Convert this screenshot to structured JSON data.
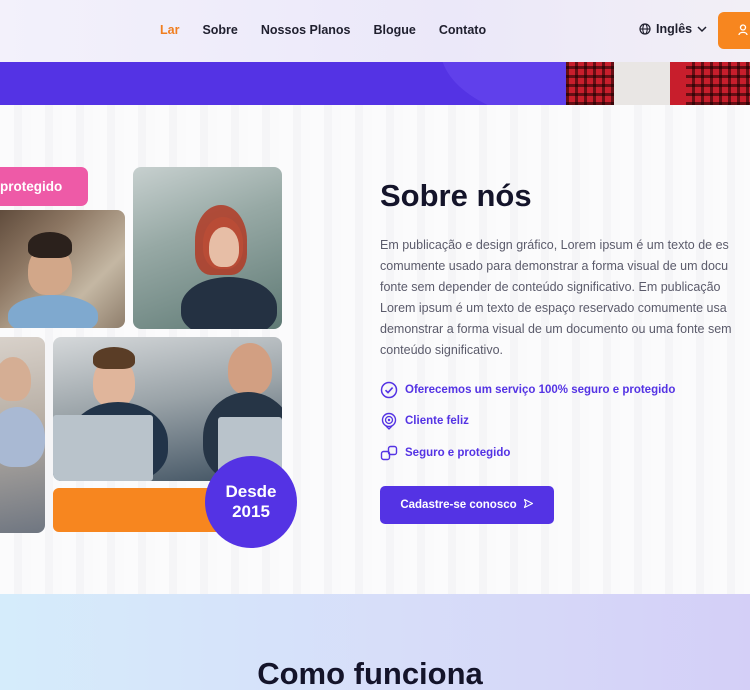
{
  "header": {
    "nav": [
      {
        "label": "Lar",
        "active": true
      },
      {
        "label": "Sobre"
      },
      {
        "label": "Nossos Planos"
      },
      {
        "label": "Blogue"
      },
      {
        "label": "Contato"
      }
    ],
    "language": "Inglês",
    "accent_color": "#f07e1f"
  },
  "about": {
    "tag": "protegido",
    "badge_line1": "Desde",
    "badge_line2": "2015",
    "title": "Sobre nós",
    "paragraph_lines": [
      "Em publicação e design gráfico, Lorem ipsum é um texto de es",
      "comumente usado para demonstrar a forma visual de um docu",
      "fonte sem depender de conteúdo significativo. Em publicação",
      "Lorem ipsum é um texto de espaço reservado comumente usa",
      "demonstrar a forma visual de um documento ou uma fonte sem",
      "conteúdo significativo."
    ],
    "features": [
      {
        "icon": "check-circle-icon",
        "label": "Oferecemos um serviço 100% seguro e protegido"
      },
      {
        "icon": "happy-badge-icon",
        "label": "Cliente feliz"
      },
      {
        "icon": "secure-link-icon",
        "label": "Seguro e protegido"
      }
    ],
    "cta_label": "Cadastre-se conosco",
    "colors": {
      "primary": "#5433e4",
      "pink": "#ee5aa7",
      "orange": "#f7861f"
    }
  },
  "how": {
    "title": "Como funciona"
  }
}
